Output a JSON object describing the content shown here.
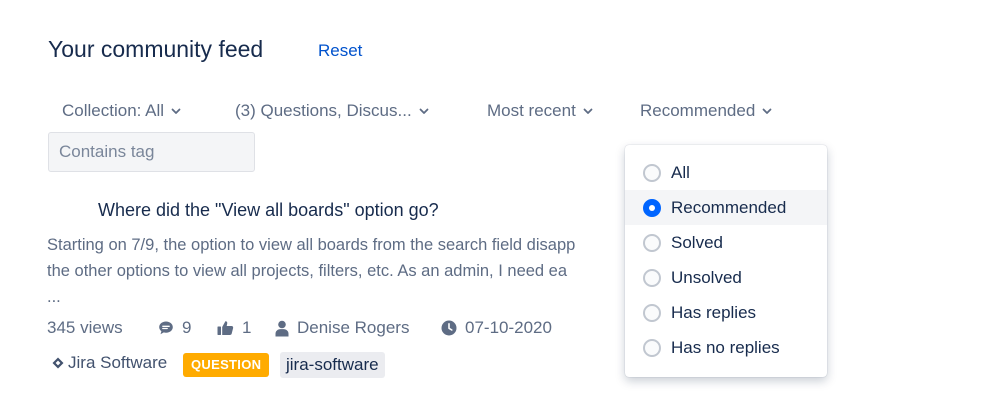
{
  "header": {
    "title": "Your community feed",
    "reset_label": "Reset"
  },
  "filters": {
    "collection": "Collection: All",
    "types": "(3) Questions, Discus...",
    "sort": "Most recent",
    "recommended": "Recommended"
  },
  "tag_input": {
    "placeholder": "Contains tag",
    "value": ""
  },
  "post": {
    "title": "Where did the \"View all boards\" option go?",
    "excerpt_lines": [
      "Starting on 7/9, the option to view all boards from the search field disapp",
      "the other options to view all projects, filters, etc.  As an admin, I need ea",
      "..."
    ],
    "views": "345 views",
    "comments": "9",
    "likes": "1",
    "author": "Denise Rogers",
    "date": "07-10-2020",
    "product": "Jira Software",
    "badge": "QUESTION",
    "tag": "jira-software"
  },
  "dropdown": {
    "options": [
      {
        "label": "All",
        "selected": false
      },
      {
        "label": "Recommended",
        "selected": true
      },
      {
        "label": "Solved",
        "selected": false
      },
      {
        "label": "Unsolved",
        "selected": false
      },
      {
        "label": "Has replies",
        "selected": false
      },
      {
        "label": "Has no replies",
        "selected": false
      }
    ]
  },
  "colors": {
    "link": "#0052cc",
    "muted": "#5e6c84",
    "badge": "#ffab00",
    "radio_selected": "#0065ff"
  }
}
